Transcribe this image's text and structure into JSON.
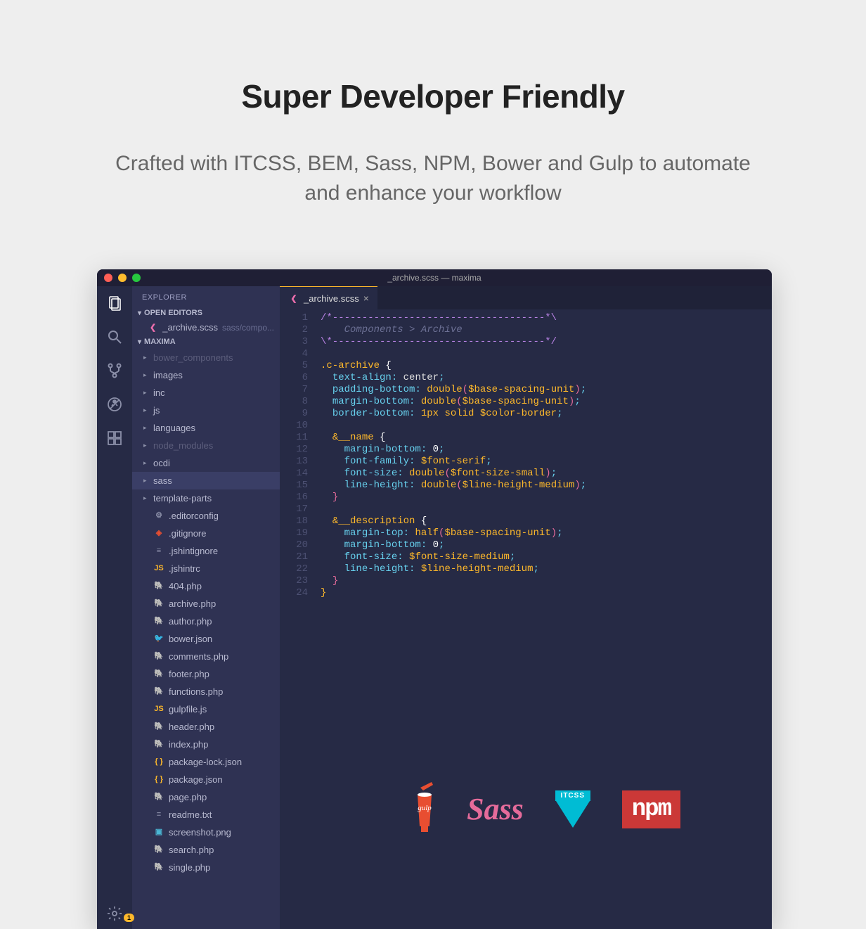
{
  "hero": {
    "title": "Super Developer Friendly",
    "subtitle": "Crafted with ITCSS, BEM, Sass, NPM, Bower and Gulp to automate and enhance your workflow"
  },
  "titlebar": {
    "text": "_archive.scss — maxima"
  },
  "sidebar": {
    "title": "EXPLORER",
    "sections": {
      "open_editors": "OPEN EDITORS",
      "project": "MAXIMA"
    },
    "open_editor": {
      "name": "_archive.scss",
      "path": "sass/compo..."
    },
    "folders": [
      {
        "label": "bower_components",
        "dimmed": true
      },
      {
        "label": "images",
        "dimmed": false
      },
      {
        "label": "inc",
        "dimmed": false
      },
      {
        "label": "js",
        "dimmed": false
      },
      {
        "label": "languages",
        "dimmed": false
      },
      {
        "label": "node_modules",
        "dimmed": true
      },
      {
        "label": "ocdi",
        "dimmed": false
      },
      {
        "label": "sass",
        "dimmed": false,
        "active": true
      },
      {
        "label": "template-parts",
        "dimmed": false
      }
    ],
    "files": [
      {
        "label": ".editorconfig",
        "icon": "gear"
      },
      {
        "label": ".gitignore",
        "icon": "git"
      },
      {
        "label": ".jshintignore",
        "icon": "lines"
      },
      {
        "label": ".jshintrc",
        "icon": "js"
      },
      {
        "label": "404.php",
        "icon": "php"
      },
      {
        "label": "archive.php",
        "icon": "php"
      },
      {
        "label": "author.php",
        "icon": "php"
      },
      {
        "label": "bower.json",
        "icon": "bower"
      },
      {
        "label": "comments.php",
        "icon": "php"
      },
      {
        "label": "footer.php",
        "icon": "php"
      },
      {
        "label": "functions.php",
        "icon": "php"
      },
      {
        "label": "gulpfile.js",
        "icon": "js"
      },
      {
        "label": "header.php",
        "icon": "php"
      },
      {
        "label": "index.php",
        "icon": "php"
      },
      {
        "label": "package-lock.json",
        "icon": "json"
      },
      {
        "label": "package.json",
        "icon": "json"
      },
      {
        "label": "page.php",
        "icon": "php"
      },
      {
        "label": "readme.txt",
        "icon": "txt"
      },
      {
        "label": "screenshot.png",
        "icon": "img"
      },
      {
        "label": "search.php",
        "icon": "php"
      },
      {
        "label": "single.php",
        "icon": "php"
      }
    ]
  },
  "tab": {
    "label": "_archive.scss"
  },
  "code": {
    "lines": 24,
    "content": [
      {
        "n": 1,
        "seg": [
          {
            "t": "/*------------------------------------*\\",
            "c": "c-purple"
          }
        ]
      },
      {
        "n": 2,
        "seg": [
          {
            "t": "    Components > Archive",
            "c": "c-comment"
          }
        ]
      },
      {
        "n": 3,
        "seg": [
          {
            "t": "\\*------------------------------------*/",
            "c": "c-purple"
          }
        ]
      },
      {
        "n": 4,
        "seg": []
      },
      {
        "n": 5,
        "seg": [
          {
            "t": ".c-archive",
            "c": "c-selector"
          },
          {
            "t": " {",
            "c": "c-brace"
          }
        ]
      },
      {
        "n": 6,
        "seg": [
          {
            "t": "  ",
            "c": ""
          },
          {
            "t": "text-align",
            "c": "c-prop"
          },
          {
            "t": ": ",
            "c": "c-punct"
          },
          {
            "t": "center",
            "c": "c-value"
          },
          {
            "t": ";",
            "c": "c-punct"
          }
        ]
      },
      {
        "n": 7,
        "seg": [
          {
            "t": "  ",
            "c": ""
          },
          {
            "t": "padding-bottom",
            "c": "c-prop"
          },
          {
            "t": ": ",
            "c": "c-punct"
          },
          {
            "t": "double",
            "c": "c-func"
          },
          {
            "t": "(",
            "c": "c-paren"
          },
          {
            "t": "$base-spacing-unit",
            "c": "c-var"
          },
          {
            "t": ")",
            "c": "c-paren"
          },
          {
            "t": ";",
            "c": "c-punct"
          }
        ]
      },
      {
        "n": 8,
        "seg": [
          {
            "t": "  ",
            "c": ""
          },
          {
            "t": "margin-bottom",
            "c": "c-prop"
          },
          {
            "t": ": ",
            "c": "c-punct"
          },
          {
            "t": "double",
            "c": "c-func"
          },
          {
            "t": "(",
            "c": "c-paren"
          },
          {
            "t": "$base-spacing-unit",
            "c": "c-var"
          },
          {
            "t": ")",
            "c": "c-paren"
          },
          {
            "t": ";",
            "c": "c-punct"
          }
        ]
      },
      {
        "n": 9,
        "seg": [
          {
            "t": "  ",
            "c": ""
          },
          {
            "t": "border-bottom",
            "c": "c-prop"
          },
          {
            "t": ": ",
            "c": "c-punct"
          },
          {
            "t": "1px solid $color-border",
            "c": "c-var"
          },
          {
            "t": ";",
            "c": "c-punct"
          }
        ]
      },
      {
        "n": 10,
        "seg": []
      },
      {
        "n": 11,
        "seg": [
          {
            "t": "  ",
            "c": ""
          },
          {
            "t": "&__name",
            "c": "c-selector"
          },
          {
            "t": " {",
            "c": "c-brace"
          }
        ]
      },
      {
        "n": 12,
        "seg": [
          {
            "t": "    ",
            "c": ""
          },
          {
            "t": "margin-bottom",
            "c": "c-prop"
          },
          {
            "t": ": ",
            "c": "c-punct"
          },
          {
            "t": "0",
            "c": "c-white"
          },
          {
            "t": ";",
            "c": "c-punct"
          }
        ]
      },
      {
        "n": 13,
        "seg": [
          {
            "t": "    ",
            "c": ""
          },
          {
            "t": "font-family",
            "c": "c-prop"
          },
          {
            "t": ": ",
            "c": "c-punct"
          },
          {
            "t": "$font-serif",
            "c": "c-var"
          },
          {
            "t": ";",
            "c": "c-punct"
          }
        ]
      },
      {
        "n": 14,
        "seg": [
          {
            "t": "    ",
            "c": ""
          },
          {
            "t": "font-size",
            "c": "c-prop"
          },
          {
            "t": ": ",
            "c": "c-punct"
          },
          {
            "t": "double",
            "c": "c-func"
          },
          {
            "t": "(",
            "c": "c-paren"
          },
          {
            "t": "$font-size-small",
            "c": "c-var"
          },
          {
            "t": ")",
            "c": "c-paren"
          },
          {
            "t": ";",
            "c": "c-punct"
          }
        ]
      },
      {
        "n": 15,
        "seg": [
          {
            "t": "    ",
            "c": ""
          },
          {
            "t": "line-height",
            "c": "c-prop"
          },
          {
            "t": ": ",
            "c": "c-punct"
          },
          {
            "t": "double",
            "c": "c-func"
          },
          {
            "t": "(",
            "c": "c-paren"
          },
          {
            "t": "$line-height-medium",
            "c": "c-var"
          },
          {
            "t": ")",
            "c": "c-paren"
          },
          {
            "t": ";",
            "c": "c-punct"
          }
        ]
      },
      {
        "n": 16,
        "seg": [
          {
            "t": "  ",
            "c": ""
          },
          {
            "t": "}",
            "c": "c-paren"
          }
        ]
      },
      {
        "n": 17,
        "seg": []
      },
      {
        "n": 18,
        "seg": [
          {
            "t": "  ",
            "c": ""
          },
          {
            "t": "&__description",
            "c": "c-selector"
          },
          {
            "t": " {",
            "c": "c-brace"
          }
        ]
      },
      {
        "n": 19,
        "seg": [
          {
            "t": "    ",
            "c": ""
          },
          {
            "t": "margin-top",
            "c": "c-prop"
          },
          {
            "t": ": ",
            "c": "c-punct"
          },
          {
            "t": "half",
            "c": "c-func"
          },
          {
            "t": "(",
            "c": "c-paren"
          },
          {
            "t": "$base-spacing-unit",
            "c": "c-var"
          },
          {
            "t": ")",
            "c": "c-paren"
          },
          {
            "t": ";",
            "c": "c-punct"
          }
        ]
      },
      {
        "n": 20,
        "seg": [
          {
            "t": "    ",
            "c": ""
          },
          {
            "t": "margin-bottom",
            "c": "c-prop"
          },
          {
            "t": ": ",
            "c": "c-punct"
          },
          {
            "t": "0",
            "c": "c-white"
          },
          {
            "t": ";",
            "c": "c-punct"
          }
        ]
      },
      {
        "n": 21,
        "seg": [
          {
            "t": "    ",
            "c": ""
          },
          {
            "t": "font-size",
            "c": "c-prop"
          },
          {
            "t": ": ",
            "c": "c-punct"
          },
          {
            "t": "$font-size-medium",
            "c": "c-var"
          },
          {
            "t": ";",
            "c": "c-punct"
          }
        ]
      },
      {
        "n": 22,
        "seg": [
          {
            "t": "    ",
            "c": ""
          },
          {
            "t": "line-height",
            "c": "c-prop"
          },
          {
            "t": ": ",
            "c": "c-punct"
          },
          {
            "t": "$line-height-medium",
            "c": "c-var"
          },
          {
            "t": ";",
            "c": "c-punct"
          }
        ]
      },
      {
        "n": 23,
        "seg": [
          {
            "t": "  ",
            "c": ""
          },
          {
            "t": "}",
            "c": "c-paren"
          }
        ]
      },
      {
        "n": 24,
        "seg": [
          {
            "t": "}",
            "c": "c-selector"
          }
        ]
      }
    ]
  },
  "badge": "1",
  "logos": {
    "gulp": "Gulp",
    "sass": "Sass",
    "itcss": "ITCSS",
    "npm": "npm"
  },
  "icons": {
    "sass": "❮",
    "gear": "⚙",
    "git": "◈",
    "lines": "≡",
    "js": "JS",
    "php": "🐘",
    "bower": "🐦",
    "json": "{ }",
    "txt": "≡",
    "img": "▣"
  }
}
